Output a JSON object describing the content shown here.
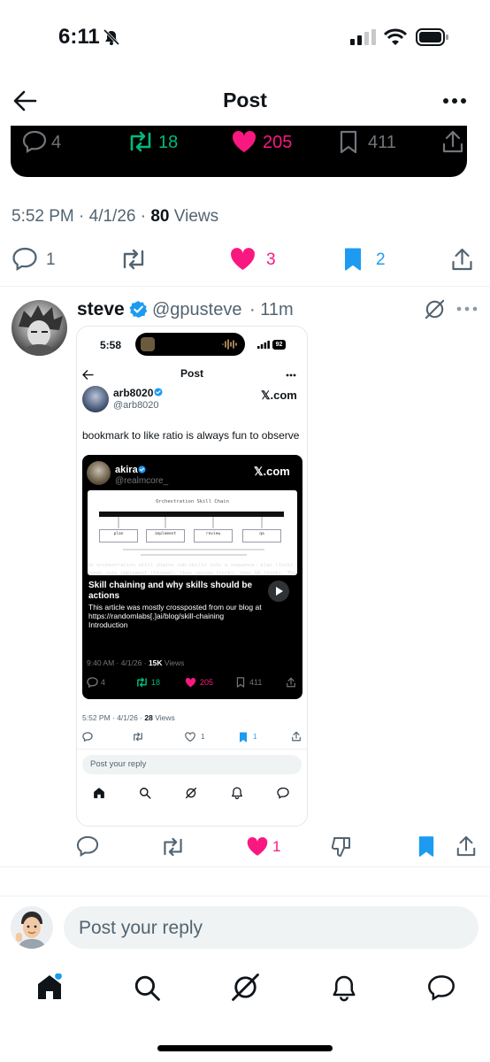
{
  "status_bar": {
    "time": "6:11"
  },
  "header": {
    "title": "Post"
  },
  "quoted_card": {
    "replies": "4",
    "reposts": "18",
    "likes": "205",
    "bookmarks": "411"
  },
  "post_meta": {
    "time_date": "5:52 PM · 4/1/26 · ",
    "views_count": "80",
    "views_label": " Views"
  },
  "post_actions": {
    "replies": "1",
    "likes": "3",
    "bookmarks": "2"
  },
  "reply_post": {
    "name": "steve",
    "handle": "@gpusteve",
    "time": "· 11m",
    "actions": {
      "likes": "1"
    }
  },
  "screenshot": {
    "time": "5:58",
    "battery": "92",
    "title": "Post",
    "author_name": "arb8020",
    "author_handle": "@arb8020",
    "source": "𝕏.com",
    "text": "bookmark to like ratio is always fun to observe",
    "inner": {
      "author_name": "akira",
      "author_handle": "@realmcore_",
      "source": "𝕏.com",
      "diagram_title": "Orchestration Skill Chain",
      "diagram_boxes": [
        "plan",
        "implement",
        "review",
        "qa"
      ],
      "caption_1": "An orchestration skill chains sub-skills into a sequence: plan (fork)",
      "caption_2": "feeds into implement (thread), then review (fork), then QA (fork). The",
      "article_title": "Skill chaining and why skills should be actions",
      "article_body": "This article was mostly crossposted from our blog at https://randomlabs[.]ai/blog/skill-chaining",
      "article_intro": "Introduction",
      "meta_time": "9:40 AM · 4/1/26 · ",
      "meta_views": "15K",
      "meta_views_label": " Views",
      "replies": "4",
      "reposts": "18",
      "likes": "205",
      "bookmarks": "411"
    },
    "meta_time": "5:52 PM · 4/1/26 · ",
    "meta_views": "28",
    "meta_views_label": " Views",
    "likes": "1",
    "bookmarks": "1",
    "reply_placeholder": "Post your reply"
  },
  "composer": {
    "placeholder": "Post your reply"
  },
  "colors": {
    "like_pink": "#f91880",
    "repost_green": "#00ba7c",
    "blue": "#1d9bf0",
    "text_gray": "#536471"
  },
  "icons": [
    "back-arrow-icon",
    "more-icon",
    "reply-icon",
    "repost-icon",
    "heart-icon",
    "bookmark-icon",
    "share-icon",
    "verified-icon",
    "grok-icon",
    "dislike-icon",
    "home-icon",
    "search-icon",
    "bell-icon",
    "messages-icon"
  ]
}
